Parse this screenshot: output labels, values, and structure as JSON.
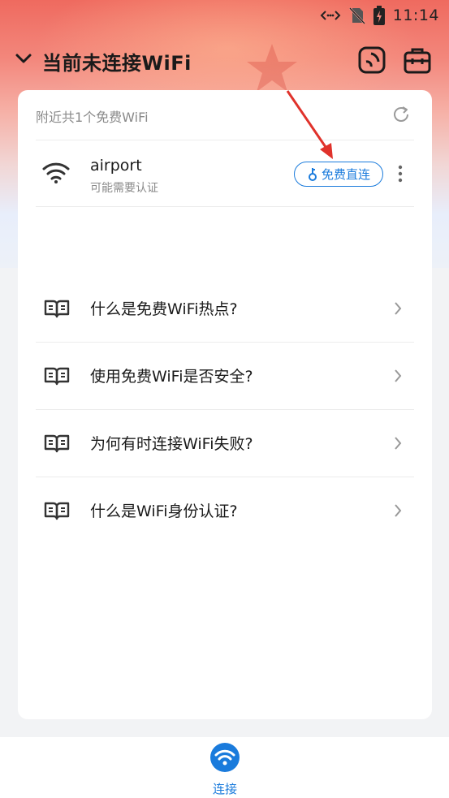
{
  "status_bar": {
    "time": "11:14",
    "icons": [
      "data-transfer-icon",
      "no-sim-icon",
      "battery-charging-icon"
    ]
  },
  "header": {
    "title": "当前未连接WiFi",
    "icons": [
      "chevron-down-icon",
      "scan-icon",
      "toolbox-icon"
    ]
  },
  "card": {
    "nearby_label": "附近共1个免费WiFi",
    "wifi_list": [
      {
        "ssid": "airport",
        "subtitle": "可能需要认证",
        "action_label": "免费直连"
      }
    ],
    "faq": [
      {
        "label": "什么是免费WiFi热点?"
      },
      {
        "label": "使用免费WiFi是否安全?"
      },
      {
        "label": "为何有时连接WiFi失败?"
      },
      {
        "label": "什么是WiFi身份认证?"
      }
    ]
  },
  "bottom_nav": {
    "tabs": [
      {
        "label": "连接",
        "active": true
      }
    ]
  },
  "colors": {
    "accent": "#1a7bdc",
    "header_gradient_top": "#ef6a5f",
    "annotation_arrow": "#e0322b"
  }
}
